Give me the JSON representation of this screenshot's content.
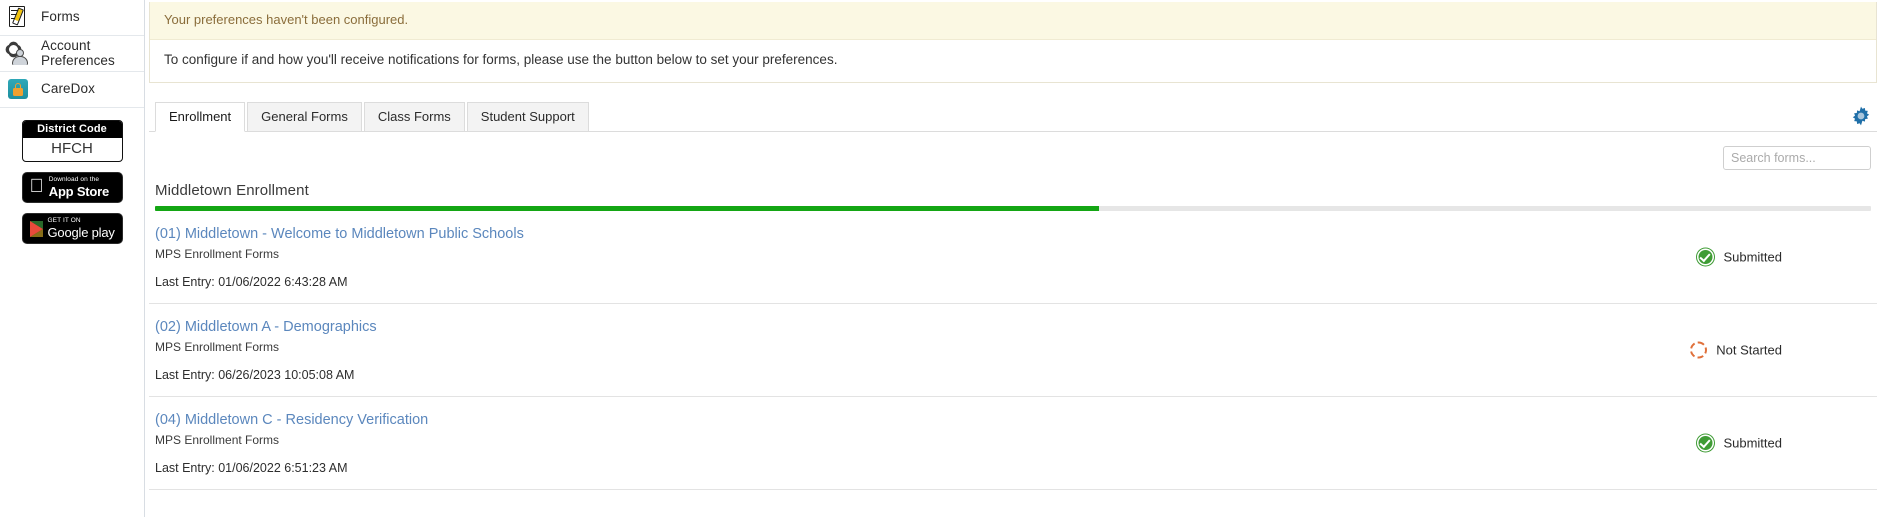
{
  "sidebar": {
    "nav_items": [
      {
        "label": "Forms",
        "icon": "forms-icon"
      },
      {
        "label": "Account Preferences",
        "icon": "account-preferences-icon"
      },
      {
        "label": "CareDox",
        "icon": "caredox-lock-icon"
      }
    ],
    "district_code": {
      "heading": "District Code",
      "value": "HFCH"
    },
    "app_store": {
      "small": "Download on the",
      "big": "App Store"
    },
    "google_play": {
      "small": "GET IT ON",
      "big": "Google play"
    }
  },
  "alert": {
    "heading": "Your preferences haven't been configured.",
    "body": "To configure if and how you'll receive notifications for forms, please use the button below to set your preferences."
  },
  "tabs": [
    {
      "label": "Enrollment",
      "active": true
    },
    {
      "label": "General Forms",
      "active": false
    },
    {
      "label": "Class Forms",
      "active": false
    },
    {
      "label": "Student Support",
      "active": false
    }
  ],
  "toolbar": {
    "gear_icon": "gear-icon",
    "gear_color": "#1f6fa8"
  },
  "search": {
    "placeholder": "Search forms...",
    "value": ""
  },
  "section": {
    "title": "Middletown Enrollment",
    "progress_percent": 55,
    "progress_color": "#14a614"
  },
  "forms": [
    {
      "title": "(01) Middletown - Welcome to Middletown Public Schools",
      "category": "MPS Enrollment Forms",
      "last_entry": "Last Entry: 01/06/2022 6:43:28 AM",
      "status": "Submitted",
      "status_icon": "check-circle-icon",
      "status_color": "#3f9c35"
    },
    {
      "title": "(02) Middletown A - Demographics",
      "category": "MPS Enrollment Forms",
      "last_entry": "Last Entry: 06/26/2023 10:05:08 AM",
      "status": "Not Started",
      "status_icon": "dashed-circle-icon",
      "status_color": "#e0703a"
    },
    {
      "title": "(04) Middletown C - Residency Verification",
      "category": "MPS Enrollment Forms",
      "last_entry": "Last Entry: 01/06/2022 6:51:23 AM",
      "status": "Submitted",
      "status_icon": "check-circle-icon",
      "status_color": "#3f9c35"
    }
  ]
}
